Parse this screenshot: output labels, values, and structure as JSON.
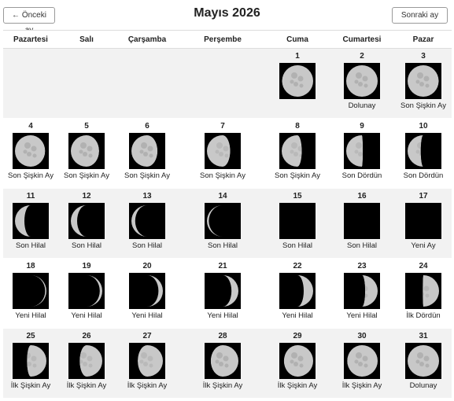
{
  "header": {
    "title": "Mayıs 2026",
    "prev_label": "← Önceki ay",
    "next_label": "Sonraki ay →"
  },
  "weekdays": [
    "Pazartesi",
    "Salı",
    "Çarşamba",
    "Perşembe",
    "Cuma",
    "Cumartesi",
    "Pazar"
  ],
  "leading_blank_days": 4,
  "days": [
    {
      "day": "1",
      "phase": "",
      "illum": 0.99,
      "waxing": true
    },
    {
      "day": "2",
      "phase": "Dolunay",
      "illum": 1.0,
      "waxing": true
    },
    {
      "day": "3",
      "phase": "Son Şişkin Ay",
      "illum": 0.99,
      "waxing": false
    },
    {
      "day": "4",
      "phase": "Son Şişkin Ay",
      "illum": 0.96,
      "waxing": false
    },
    {
      "day": "5",
      "phase": "Son Şişkin Ay",
      "illum": 0.9,
      "waxing": false
    },
    {
      "day": "6",
      "phase": "Son Şişkin Ay",
      "illum": 0.83,
      "waxing": false
    },
    {
      "day": "7",
      "phase": "Son Şişkin Ay",
      "illum": 0.74,
      "waxing": false
    },
    {
      "day": "8",
      "phase": "Son Şişkin Ay",
      "illum": 0.64,
      "waxing": false
    },
    {
      "day": "9",
      "phase": "Son Dördün",
      "illum": 0.53,
      "waxing": false
    },
    {
      "day": "10",
      "phase": "Son Dördün",
      "illum": 0.42,
      "waxing": false
    },
    {
      "day": "11",
      "phase": "Son Hilal",
      "illum": 0.3,
      "waxing": false
    },
    {
      "day": "12",
      "phase": "Son Hilal",
      "illum": 0.2,
      "waxing": false
    },
    {
      "day": "13",
      "phase": "Son Hilal",
      "illum": 0.12,
      "waxing": false
    },
    {
      "day": "14",
      "phase": "Son Hilal",
      "illum": 0.06,
      "waxing": false
    },
    {
      "day": "15",
      "phase": "Son Hilal",
      "illum": 0.0,
      "waxing": false
    },
    {
      "day": "16",
      "phase": "Son Hilal",
      "illum": 0.0,
      "waxing": false
    },
    {
      "day": "17",
      "phase": "Yeni Ay",
      "illum": 0.0,
      "waxing": true
    },
    {
      "day": "18",
      "phase": "Yeni Hilal",
      "illum": 0.04,
      "waxing": true
    },
    {
      "day": "19",
      "phase": "Yeni Hilal",
      "illum": 0.08,
      "waxing": true
    },
    {
      "day": "20",
      "phase": "Yeni Hilal",
      "illum": 0.14,
      "waxing": true
    },
    {
      "day": "21",
      "phase": "Yeni Hilal",
      "illum": 0.22,
      "waxing": true
    },
    {
      "day": "22",
      "phase": "Yeni Hilal",
      "illum": 0.3,
      "waxing": true
    },
    {
      "day": "23",
      "phase": "Yeni Hilal",
      "illum": 0.4,
      "waxing": true
    },
    {
      "day": "24",
      "phase": "İlk Dördün",
      "illum": 0.52,
      "waxing": true
    },
    {
      "day": "25",
      "phase": "İlk Şişkin Ay",
      "illum": 0.62,
      "waxing": true
    },
    {
      "day": "26",
      "phase": "İlk Şişkin Ay",
      "illum": 0.72,
      "waxing": true
    },
    {
      "day": "27",
      "phase": "İlk Şişkin Ay",
      "illum": 0.8,
      "waxing": true
    },
    {
      "day": "28",
      "phase": "İlk Şişkin Ay",
      "illum": 0.88,
      "waxing": true
    },
    {
      "day": "29",
      "phase": "İlk Şişkin Ay",
      "illum": 0.93,
      "waxing": true
    },
    {
      "day": "30",
      "phase": "İlk Şişkin Ay",
      "illum": 0.97,
      "waxing": true
    },
    {
      "day": "31",
      "phase": "Dolunay",
      "illum": 1.0,
      "waxing": true
    }
  ],
  "colors": {
    "row_shade": "#f2f2f2",
    "moon_bg": "#000000",
    "moon_lit": "#c8c8c8",
    "header_border": "#dcdcdc"
  },
  "icons": {
    "moon": "moon-phase-icon"
  }
}
